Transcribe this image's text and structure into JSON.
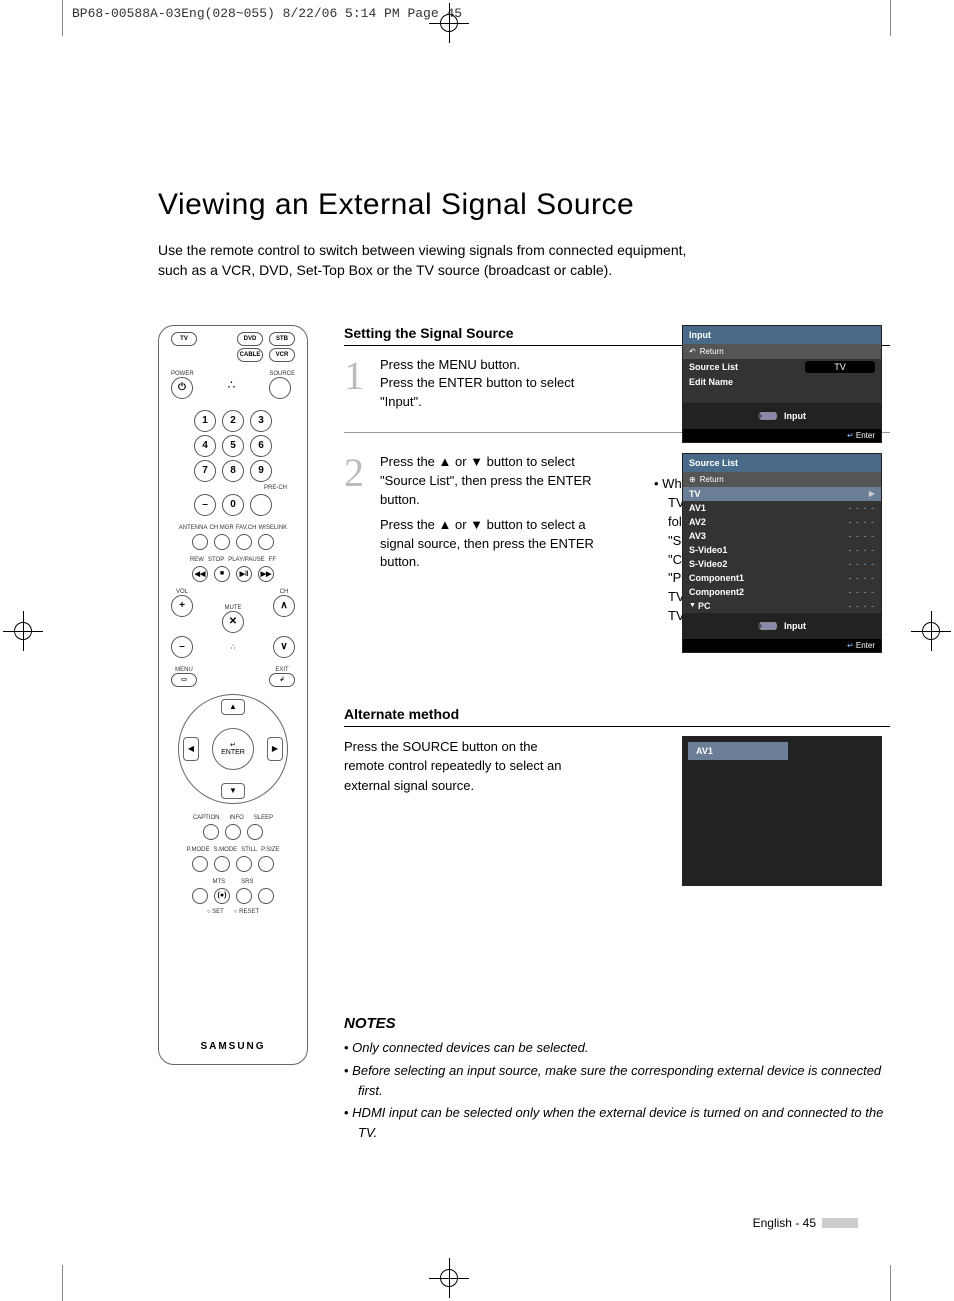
{
  "print_header": "BP68-00588A-03Eng(028~055)  8/22/06  5:14 PM  Page 45",
  "title": "Viewing an External Signal Source",
  "intro": "Use the remote control to switch between viewing signals from connected equipment, such as a VCR, DVD, Set-Top Box or the TV source (broadcast or cable).",
  "section1": "Setting the Signal Source",
  "step1": {
    "num": "1",
    "lines": [
      "Press the MENU button.",
      "Press the ENTER button to select \"Input\"."
    ]
  },
  "step2": {
    "num": "2",
    "lines": [
      "Press the ▲ or ▼ button to select \"Source List\", then press the ENTER button.",
      "Press the ▲ or ▼ button to select a signal source, then press the ENTER button."
    ],
    "bullet": "When you connect equipment to the TV, you can choose between the following sets of jacks: \"AV1\", \"AV2\", \"S-VIDEO1\", \"S-VIDEO2\", \"COMPONENT1\", \"COMPONENT2\", \"PC\", \"HDMI1\", or \"HDMI2\" on the TV's rear panel and \"AV3\" on the TV's side panel."
  },
  "section2": "Alternate method",
  "alt_text": "Press the SOURCE button on the remote control repeatedly to select an external signal source.",
  "alt_screen_label": "AV1",
  "osd1": {
    "title": "Input",
    "return": "Return",
    "rows": [
      {
        "k": "Source List",
        "v": "TV"
      },
      {
        "k": "Edit Name",
        "v": ""
      }
    ],
    "iconlabel": "Input",
    "footer": "Enter"
  },
  "osd2": {
    "title": "Source List",
    "return": "Return",
    "rows": [
      {
        "k": "TV",
        "v": "",
        "sel": true,
        "arrow": "▶"
      },
      {
        "k": "AV1",
        "v": "- - - -"
      },
      {
        "k": "AV2",
        "v": "- - - -"
      },
      {
        "k": "AV3",
        "v": "- - - -"
      },
      {
        "k": "S-Video1",
        "v": "- - - -"
      },
      {
        "k": "S-Video2",
        "v": "- - - -"
      },
      {
        "k": "Component1",
        "v": "- - - -"
      },
      {
        "k": "Component2",
        "v": "- - - -"
      },
      {
        "k": "PC",
        "v": "- - - -",
        "prefix": "▼"
      }
    ],
    "iconlabel": "Input",
    "footer": "Enter"
  },
  "notes_title": "NOTES",
  "notes": [
    "Only connected devices can be selected.",
    "Before selecting an input source, make sure the corresponding external device is connected first.",
    "HDMI input can be selected only when the external device is turned on and connected to the TV."
  ],
  "pagenum": "English - 45",
  "remote": {
    "top_row": [
      "TV",
      "DVD",
      "STB"
    ],
    "top_row2": [
      "CABLE",
      "VCR"
    ],
    "power": "POWER",
    "source": "SOURCE",
    "numpad": [
      "1",
      "2",
      "3",
      "4",
      "5",
      "6",
      "7",
      "8",
      "9",
      "–",
      "0"
    ],
    "prech": "PRE-CH",
    "small_labels": [
      "ANTENNA",
      "CH MGR",
      "FAV.CH",
      "WISELINK"
    ],
    "transport": [
      "REW",
      "STOP",
      "PLAY/PAUSE",
      "FF"
    ],
    "vol": "VOL",
    "ch": "CH",
    "mute": "MUTE",
    "menu": "MENU",
    "exit": "EXIT",
    "enter": "ENTER",
    "bottom1": [
      "CAPTION",
      "INFO",
      "SLEEP"
    ],
    "bottom2": [
      "P.MODE",
      "S.MODE",
      "STILL",
      "P.SIZE"
    ],
    "bottom3": [
      "MTS",
      "SRS"
    ],
    "setreset": [
      "○ SET",
      "○ RESET"
    ],
    "logo": "SAMSUNG"
  }
}
